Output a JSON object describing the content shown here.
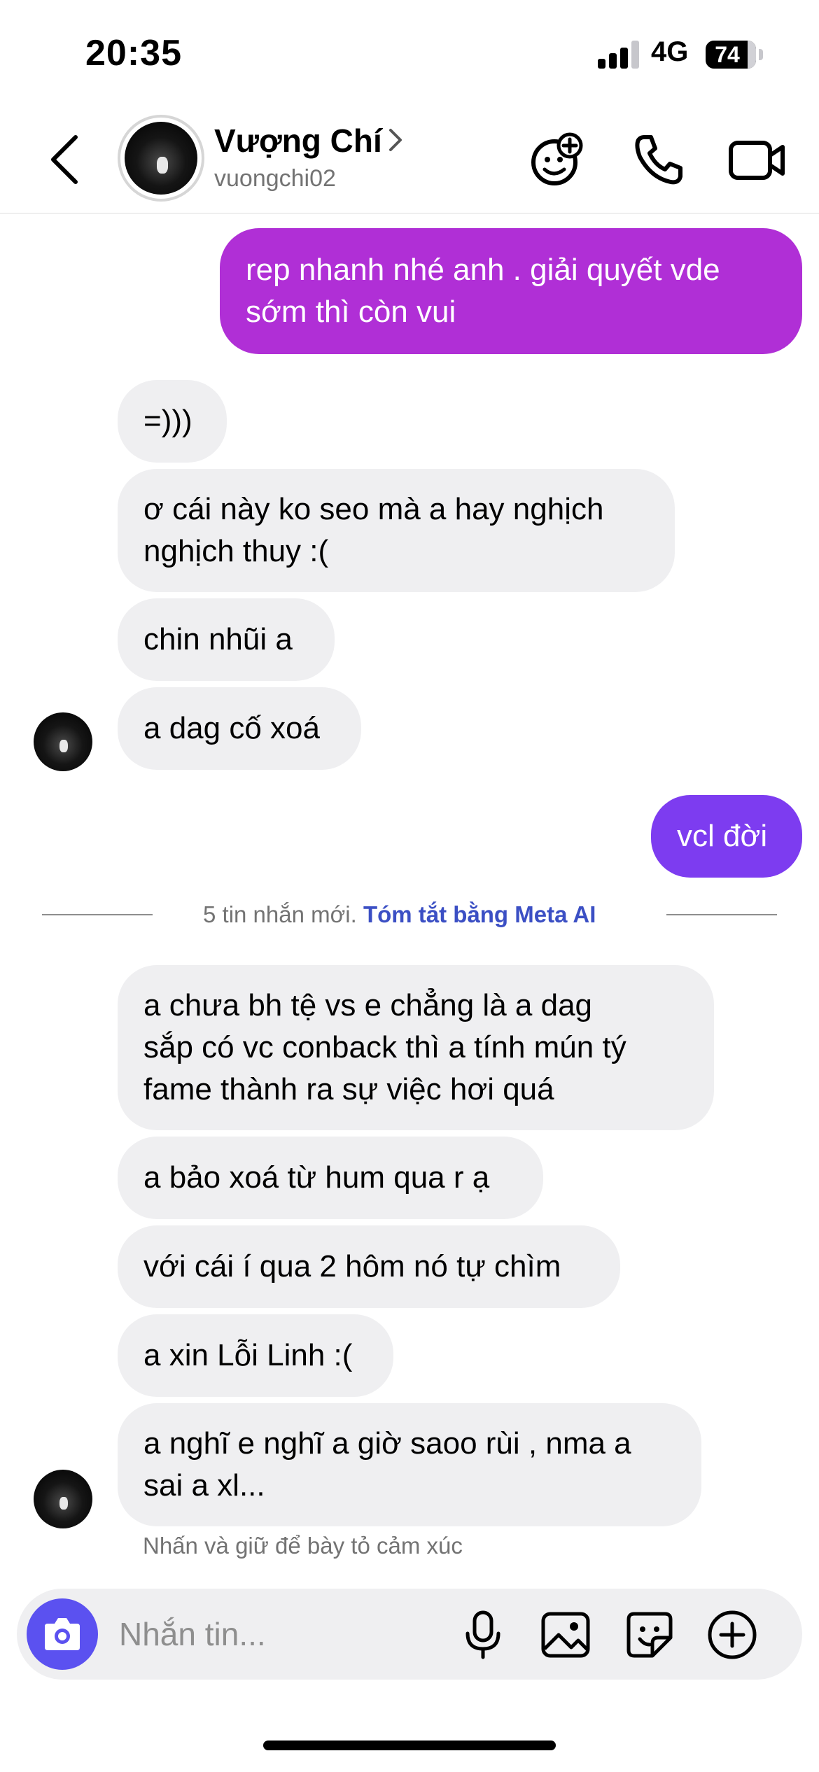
{
  "status_bar": {
    "time": "20:35",
    "network": "4G",
    "battery": "74",
    "signal_bars": 3
  },
  "header": {
    "contact_name": "Vượng Chí",
    "username": "vuongchi02",
    "icons": [
      "back-chevron-icon",
      "effects-icon",
      "phone-icon",
      "video-camera-icon"
    ]
  },
  "messages": [
    {
      "sender": "me",
      "text": "rep nhanh nhé anh . giải quyết vde\nsớm thì còn vui"
    },
    {
      "sender": "them",
      "text": "=)))"
    },
    {
      "sender": "them",
      "text": "ơ cái này ko seo mà a hay nghịch\nnghịch thuy :("
    },
    {
      "sender": "them",
      "text": "chin nhũi a"
    },
    {
      "sender": "them",
      "text": "a dag cố xoá"
    },
    {
      "sender": "me",
      "text": "vcl đời"
    },
    {
      "sender": "them",
      "text": "a chưa bh tệ vs e chẳng là a dag\nsắp có vc conback thì a tính mún tý\nfame thành ra sự việc hơi quá"
    },
    {
      "sender": "them",
      "text": "a bảo xoá từ hum qua r ạ"
    },
    {
      "sender": "them",
      "text": "với cái í qua 2 hôm nó tự chìm"
    },
    {
      "sender": "them",
      "text": "a xin Lỗi Linh :("
    },
    {
      "sender": "them",
      "text": "a nghĩ e nghĩ a giờ saoo rùi , nma a\nsai a xl..."
    }
  ],
  "divider": {
    "text": "5 tin nhắn mới.",
    "link": "Tóm tắt bằng Meta AI"
  },
  "reaction_hint": "Nhấn và giữ để bày tỏ cảm xúc",
  "composer": {
    "placeholder": "Nhắn tin...",
    "icons": [
      "camera-icon",
      "microphone-icon",
      "image-icon",
      "sticker-icon",
      "plus-icon"
    ]
  },
  "colors": {
    "outgoing_bubble_1": "#b02fd6",
    "outgoing_bubble_2": "#7d3cf0",
    "incoming_bubble": "#efeff1",
    "link": "#3b4fc4",
    "camera_button": "#5b51f0"
  }
}
